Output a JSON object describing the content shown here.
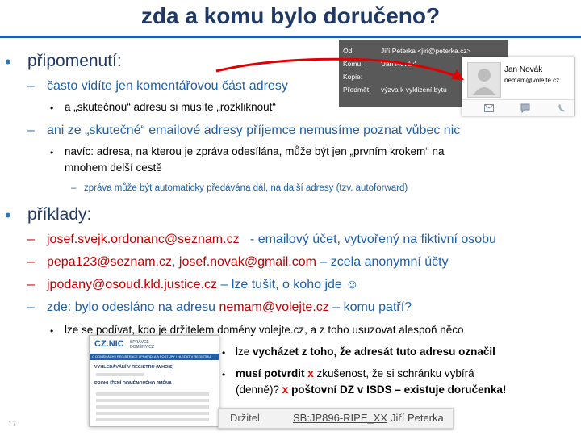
{
  "title": "zda a komu bylo doručeno?",
  "bullets": {
    "symbol": "•",
    "dash": "–",
    "small_dot": "•"
  },
  "section1": {
    "heading": "připomenutí:",
    "item1": "často vidíte jen komentářovou část adresy",
    "item1_sub": "a „skutečnou“ adresu si musíte „rozkliknout“",
    "item2": "ani ze „skutečné“ emailové adresy příjemce nemusíme poznat vůbec nic",
    "item2_sub_line1": "navíc: adresa, na kterou je zpráva odesílána, může být jen „prvním krokem“ na",
    "item2_sub_line2": "mnohem delší cestě",
    "item2_subsub": "zpráva může být automaticky předávána dál, na další adresy (tzv. autoforward)"
  },
  "section2": {
    "heading": "příklady:",
    "ex1_addr": "josef.svejk.ordonanc@seznam.cz",
    "ex1_text": "- emailový účet, vytvořený na fiktivní osobu",
    "ex2_addr1": "pepa123@seznam.cz",
    "ex2_sep": ", ",
    "ex2_addr2": "josef.novak@gmail.com",
    "ex2_text": " – zcela anonymní účty",
    "ex3_addr": "jpodany@osoud.kld.justice.cz",
    "ex3_text": " – lze tušit, o koho jde ☺",
    "ex4_text": "zde: bylo odesláno na adresu ",
    "ex4_addr": "nemam@volejte.cz",
    "ex4_text2": " – komu patří?",
    "ex4_sub": "lze se podívat, kdo je držitelem domény volejte.cz, a z toho usuzovat alespoň něco",
    "note1_pre": "lze ",
    "note1_bold": "vycházet  z toho, že adresát tuto adresu označil",
    "note2_bold": "musí potvrdit",
    "note2_x": "x",
    "note2_rest": " zkušenost, že si schránku vybírá",
    "note3_pre": "(denně)? ",
    "note3_x": "x",
    "note3_bold": " poštovní DZ v ISDS – existuje doručenka!"
  },
  "email": {
    "from_label": "Od:",
    "from_value": "Jiří Peterka <jiri@peterka.cz>",
    "to_label": "Komu:",
    "to_value": "'Jan Novák'",
    "cc_label": "Kopie:",
    "subject_label": "Předmět:",
    "subject_value": "výzva k vyklizení bytu"
  },
  "contact_card": {
    "name": "Jan Novák",
    "email": "nemam@volejte.cz",
    "icons": [
      "mail-icon",
      "chat-icon",
      "phone-icon"
    ]
  },
  "registry": {
    "logo": "CZ.NIC",
    "logo_sub": "SPRÁVCE DOMÉNY CZ",
    "nav": "O DOMÉNÁCH  |  REGISTRACE  |  PRAVIDLA A POSTUPY  |  HLEDAT V REGISTRU",
    "section1": "VYHLEDÁVÁNÍ V REGISTRU (WHOIS)",
    "section2": "PROHLÍŽENÍ DOMÉNOVÉHO JMÉNA"
  },
  "holder": {
    "label": "Držitel",
    "handle": "SB:JP896-RIPE_XX",
    "name": "Jiří Peterka"
  },
  "slide_number": "17",
  "colors": {
    "title": "#1f3864",
    "accent_blue": "#1f5fa8",
    "accent_red": "#c00000"
  }
}
